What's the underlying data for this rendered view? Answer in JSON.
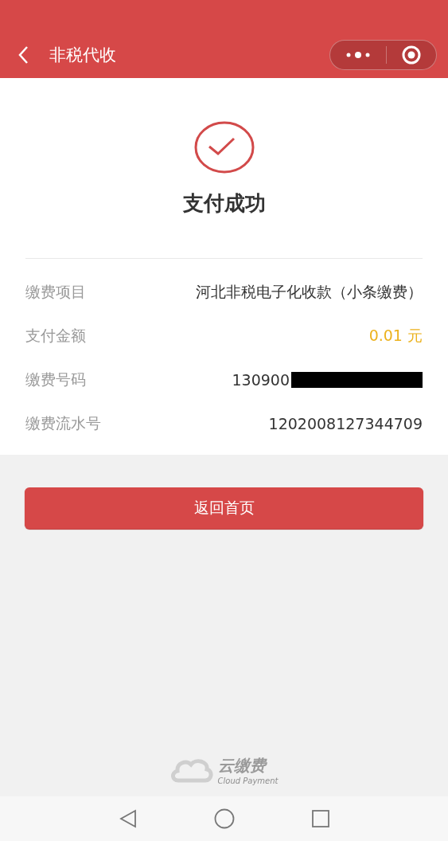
{
  "header": {
    "title": "非税代收"
  },
  "result": {
    "title": "支付成功"
  },
  "details": [
    {
      "label": "缴费项目",
      "value": "河北非税电子化收款（小条缴费）",
      "kind": "text"
    },
    {
      "label": "支付金额",
      "value": "0.01 元",
      "kind": "amount"
    },
    {
      "label": "缴费号码",
      "value": "130900",
      "kind": "redacted"
    },
    {
      "label": "缴费流水号",
      "value": "1202008127344709",
      "kind": "text"
    }
  ],
  "button": {
    "label": "返回首页"
  },
  "footer": {
    "brand": "云缴费",
    "brand_en": "Cloud Payment"
  }
}
